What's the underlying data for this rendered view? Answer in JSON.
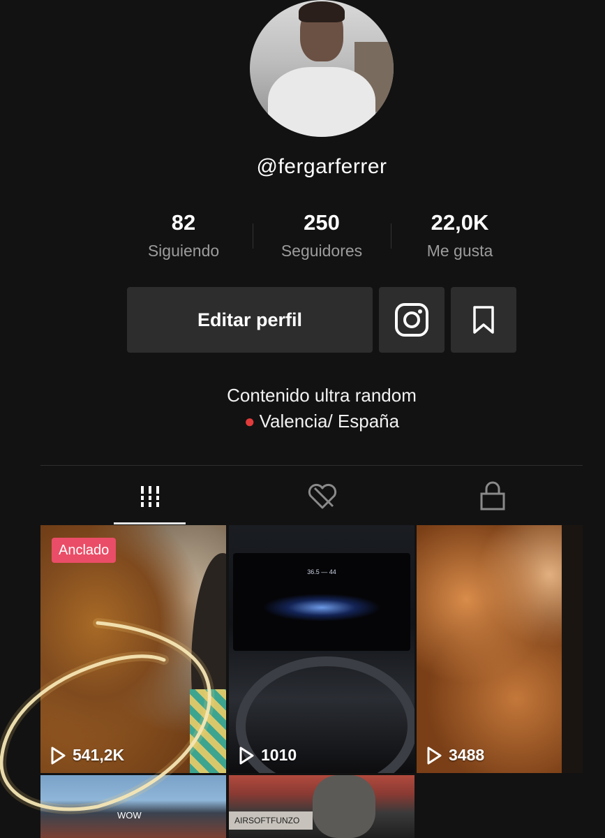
{
  "profile": {
    "username": "@fergarferrer",
    "stats": [
      {
        "value": "82",
        "label": "Siguiendo"
      },
      {
        "value": "250",
        "label": "Seguidores"
      },
      {
        "value": "22,0K",
        "label": "Me gusta"
      }
    ],
    "edit_button_label": "Editar perfil",
    "bio_line1": "Contenido ultra random",
    "bio_line2": "Valencia/ España"
  },
  "tabs": [
    {
      "icon": "grid-icon",
      "active": true
    },
    {
      "icon": "liked-hidden-icon",
      "active": false
    },
    {
      "icon": "lock-icon",
      "active": false
    }
  ],
  "videos": [
    {
      "pinned_label": "Anclado",
      "views": "541,2K"
    },
    {
      "views": "1010",
      "overlay_text": "36.5 — 44"
    },
    {
      "views": "3488"
    },
    {
      "overlay_text": "WOW"
    },
    {
      "overlay_text": "AIRSOFTFUNZO"
    }
  ],
  "colors": {
    "background": "#121212",
    "button_bg": "#2d2d2d",
    "pinned_badge": "#ea4d67",
    "highlight_circle": "#f4eac2"
  }
}
